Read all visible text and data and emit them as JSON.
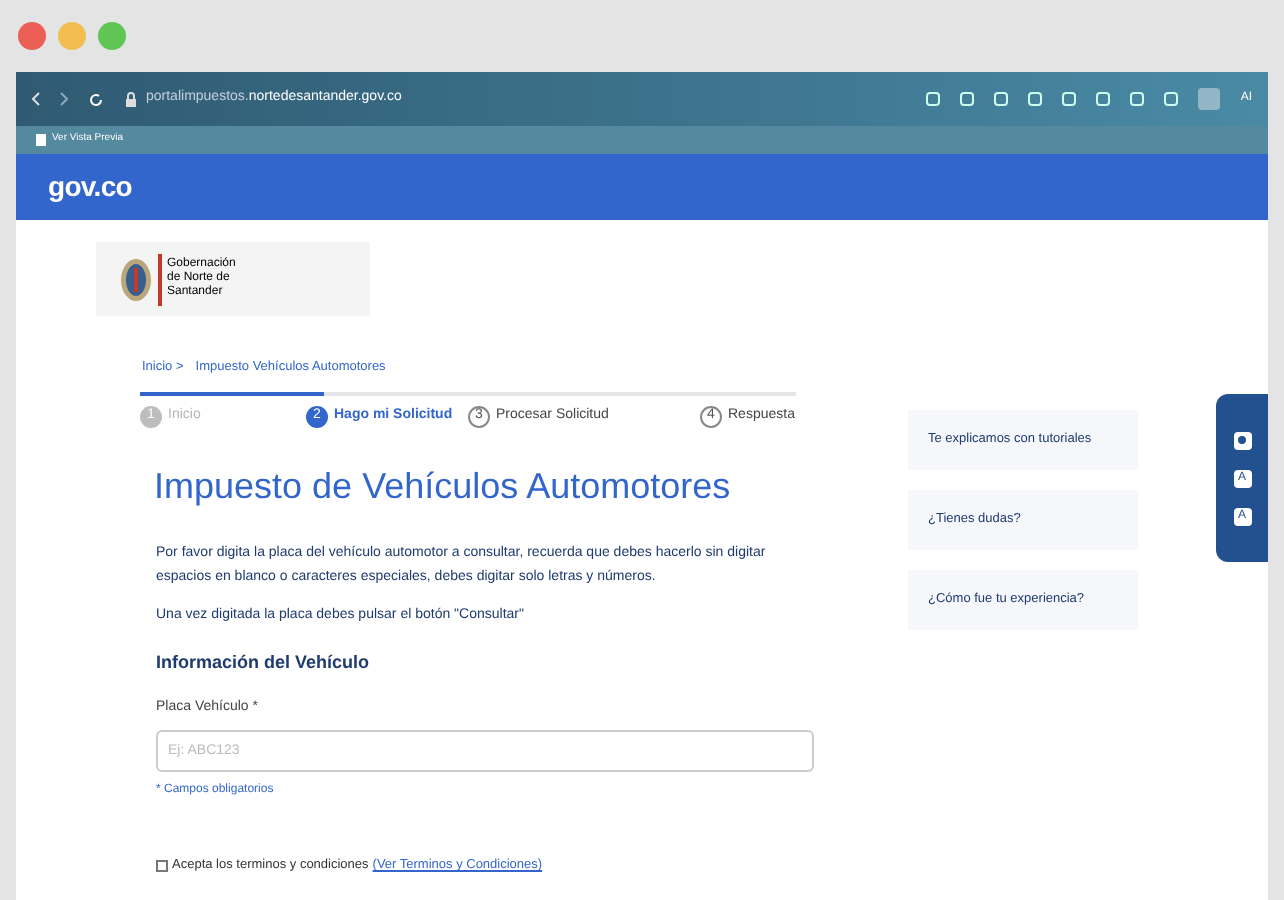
{
  "browser": {
    "url_host": "portalimpuestos.",
    "url_domain": "nortedesantander.gov.co",
    "bookmark": "Ver Vista Previa",
    "toolbar_label": "AI"
  },
  "header": {
    "logo": "gov.co"
  },
  "entity": {
    "lines": [
      "Gobernación",
      "de Norte de",
      "Santander"
    ]
  },
  "breadcrumb": [
    {
      "label": "Inicio >"
    },
    {
      "label": "Impuesto Vehículos Automotores"
    }
  ],
  "progress": {
    "level": 0.28
  },
  "steps": [
    {
      "number": "1",
      "label": "Inicio",
      "completed": true,
      "selected": false
    },
    {
      "number": "2",
      "label": "Hago mi Solicitud",
      "completed": false,
      "selected": true
    },
    {
      "number": "3",
      "label": "Procesar Solicitud",
      "completed": false,
      "selected": false
    },
    {
      "number": "4",
      "label": "Respuesta",
      "completed": false,
      "selected": false
    }
  ],
  "title": "Impuesto de Vehículos Automotores",
  "paragraphs": [
    "Por favor digita la placa del vehículo automotor a consultar, recuerda que debes hacerlo sin digitar espacios en blanco o caracteres especiales, debes digitar solo letras y números.",
    "Una vez digitada la placa debes pulsar el botón \"Consultar\""
  ],
  "section_title": "Información del Vehículo",
  "field": {
    "label": "Placa Vehículo *",
    "placeholder": "Ej: ABC123"
  },
  "required_note": "* Campos obligatorios",
  "terms": {
    "checked": false,
    "label": "Acepta los terminos y condiciones",
    "link": "(Ver Terminos y Condiciones)"
  },
  "side_cards": [
    {
      "label": "Te explicamos con tutoriales"
    },
    {
      "label": "¿Tienes dudas?"
    },
    {
      "label": "¿Cómo fue tu experiencia?"
    }
  ],
  "accessibility": [
    {
      "kind": "contrast"
    },
    {
      "kind": "text",
      "label": "A"
    },
    {
      "kind": "text",
      "label": "A"
    }
  ]
}
